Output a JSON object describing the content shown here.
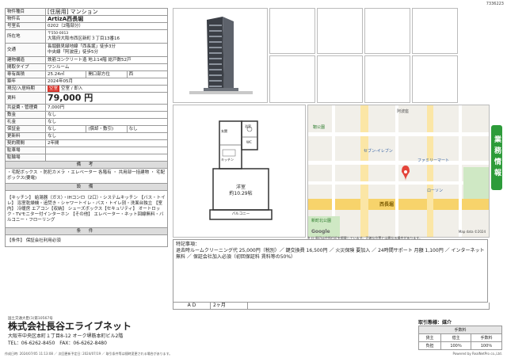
{
  "doc_id": "7336223",
  "property": {
    "rows": [
      {
        "key": "物件種目",
        "value": "[住居用] マンション"
      },
      {
        "key": "物件名",
        "value": "ArtizA西長堀"
      },
      {
        "key": "号室名",
        "value": "0202（2階部分）"
      }
    ],
    "address_key": "所在地",
    "address_zip": "〒550-0013",
    "address_value": "大阪府大阪市西区新町３丁目13番16",
    "transport_key": "交通",
    "transport_line1": "長堀鶴見緑地線「西長堀」徒歩3分",
    "transport_line2": "中央線「阿波座」徒歩5分",
    "structure_key": "建物構造",
    "structure_value": "鉄筋コンクリート造 地上14階 総戸数52戸",
    "layout_key": "間取タイプ",
    "layout_value": "ワンルーム",
    "area_key": "専有面積",
    "area_value": "25.24㎡",
    "aspect_key": "開口部方位",
    "aspect_value": "西",
    "built_key": "築年",
    "built_value": "2024年05月",
    "status_key": "現況/入居時期",
    "status_badge": "空室",
    "status_value": "空室 / 即入",
    "rent_key": "賃料",
    "rent_value": "79,000 円",
    "mgmt_key": "共益費・管理費",
    "mgmt_value": "7,000円",
    "deposit_key": "敷金",
    "deposit_value": "なし",
    "keymoney_key": "礼金",
    "keymoney_value": "なし",
    "guarantee_key": "保証金",
    "guarantee_value": "なし",
    "amort_key": "(償却・敷引)",
    "amort_value": "なし",
    "renewal_key": "更新料",
    "renewal_value": "なし",
    "contract_key": "契約期間",
    "contract_value": "2年間",
    "parking_key": "駐車場",
    "parking_value": "",
    "bike_key": "駐輪場",
    "bike_value": ""
  },
  "sections": {
    "notes_header": "備 考",
    "notes_text": "・宅配ボックス ・防犯カメラ ・エレベーター 各階有 ・ 共用部一括建物 ・ 宅配ボックス(要電)",
    "equipment_header": "設 備",
    "equipment_text": "【キッチン】 給湯器（ガス）・IHコンロ（2口）・システムキッチン 【バス・トイレ】 浴室乾燥機・追焚き・シャワートイレ・バス・トイレ別・洗面台独立 【室内】 冷暖房 エアコン【収納】 シューズボックス【セキュリティ】 オートロック・TVモニター付インターホン 【その他】 エレベーター・ネット回線無料・バルコニー・フローリング",
    "conditions_header": "条 件",
    "conditions_text": "【条件】 保証会社利用必須"
  },
  "map": {
    "station_label": "西長堀",
    "labels": [
      "阿波座",
      "靭公園",
      "ファミリーマート",
      "ローソン",
      "新町北公園",
      "セブン-イレブン",
      "Google"
    ],
    "caption": "※ 口 周辺は住所付近を掲載しています。正確な位置とは異なる場合があります。",
    "credit": "Map data ©2024"
  },
  "floorplan": {
    "room_label": "洋室",
    "room_size": "約10.29帖",
    "balcony_label": "バルコニー",
    "kitchen_label": "キッチン",
    "entrance_label": "玄関",
    "bath_label": "浴室",
    "wc_label": "WC"
  },
  "remarks": {
    "title": "特記事項：",
    "text": "退去時ルームクリーニング代 25,000円（税別）／ 鍵交換費 16,500円 ／ 火災保険 要加入 ／ 24時間サポート 月額 1,100円 ／ インターネット無料 ／ 保証会社加入必須（初回保証料 賃料等の50%）",
    "ad_label": "A D",
    "ad_value": "2ヶ月"
  },
  "company": {
    "license": "国土交通大臣(1)第10567号",
    "name": "株式会社長谷エライブネット",
    "address": "大阪市中央区本町１丁目8-12 オーク堺筋本町ビル2階",
    "tel": "TEL：06-6262-8450　FAX：06-6262-8480",
    "footer": "作成日時: 2024/07/05 11:13:08 ／ 次回更新予定日: 2024/07/19 ／ 取引条件等は随時変更される場合があります。",
    "powered": "Powered by RealNetPro co.,Ltd."
  },
  "agent": {
    "title": "取引態様：媒介",
    "sub": "手数料",
    "rows": [
      [
        "貸主",
        "借主",
        "手数料"
      ],
      [
        "負担",
        "100％",
        "100％"
      ]
    ]
  },
  "side_tab": "業務情報"
}
